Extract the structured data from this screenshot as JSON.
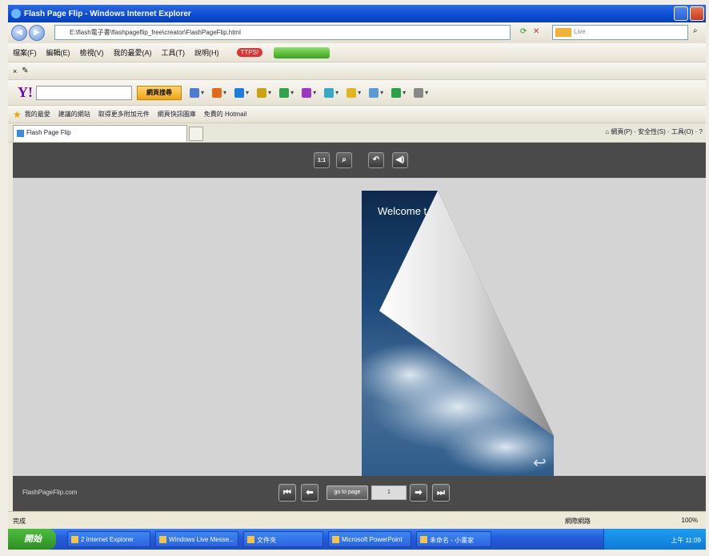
{
  "window": {
    "title": "Flash Page Flip - Windows Internet Explorer"
  },
  "address_bar": {
    "url": "E:\\flash電子書\\flashpageflip_free\\creator\\FlashPageFlip.html",
    "search_placeholder": "Live"
  },
  "menu": {
    "items": [
      "檔案(F)",
      "編輯(E)",
      "檢視(V)",
      "我的最愛(A)",
      "工具(T)",
      "說明(H)"
    ],
    "extra": "TTPS!"
  },
  "yahoo_toolbar": {
    "logo": "Y!",
    "search_button": "網頁搜尋"
  },
  "favorites_bar": {
    "label": "我的最愛",
    "items": [
      "建議的網站",
      "取得更多附加元件",
      "網頁快訊圖庫",
      "免費的 Hotmail"
    ]
  },
  "tab": {
    "label": "Flash Page Flip"
  },
  "command_bar": {
    "text": "網頁(P) · 安全性(S) · 工具(O) · ?"
  },
  "viewer": {
    "top_controls": [
      "1:1",
      "zoom",
      "flip",
      "sound"
    ],
    "page_text": "Welcome t",
    "brand": "FlashPageFlip.com",
    "goto_label": "go to page",
    "page_value": "1"
  },
  "status_bar": {
    "left": "完成",
    "zone": "網際網路",
    "zoom": "100%"
  },
  "taskbar": {
    "start_label": "開始",
    "tasks": [
      "2 Internet Explorer",
      "Windows Live Messe...",
      "文件夾",
      "Microsoft PowerPoint",
      "未命名 - 小畫家"
    ],
    "clock": "上午 11:09"
  },
  "colors": {
    "ie_blue": "#0a4bd2",
    "viewer_bar": "#4a4a4a",
    "stage": "#d4d4d4",
    "start_green": "#2e8d24"
  }
}
